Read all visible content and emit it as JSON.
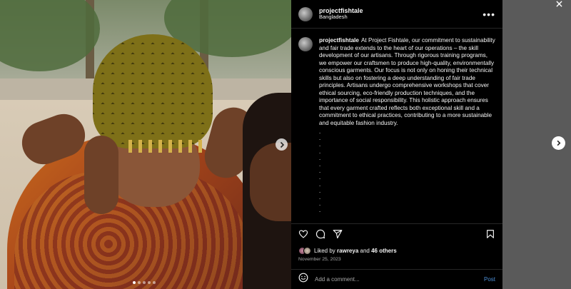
{
  "post": {
    "header": {
      "username": "projectfishtale",
      "location": "Bangladesh",
      "more_label": "•••"
    },
    "caption": {
      "username": "projectfishtale",
      "text": "At Project Fishtale, our commitment to sustainability and fair trade extends to the heart of our operations – the skill development of our artisans. Through rigorous training programs, we empower our craftsmen to produce high-quality, environmentally conscious garments. Our focus is not only on honing their technical skills but also on fostering a deep understanding of fair trade principles. Artisans undergo comprehensive workshops that cover ethical sourcing, eco-friendly production techniques, and the importance of social responsibility. This holistic approach ensures that every garment crafted reflects both exceptional skill and a commitment to ethical practices, contributing to a more sustainable and equitable fashion industry.",
      "dot_lines": [
        ".",
        ".",
        ".",
        ".",
        ".",
        ".",
        ".",
        ".",
        ".",
        ".",
        ".",
        ".",
        "."
      ]
    },
    "likes": {
      "prefix": "Liked by",
      "user": "rawreya",
      "joiner": "and",
      "others": "46 others"
    },
    "date": "November 25, 2023",
    "comment": {
      "placeholder": "Add a comment...",
      "post_label": "Post"
    },
    "carousel": {
      "slide_count": 5,
      "active_index": 0
    }
  },
  "icons": {
    "close": "close-icon",
    "next": "chevron-right-icon",
    "like": "heart-icon",
    "comment": "comment-icon",
    "share": "share-icon",
    "save": "bookmark-icon",
    "emoji": "emoji-icon",
    "more": "more-icon"
  },
  "colors": {
    "background": "#000000",
    "text": "#f5f5f5",
    "muted": "#a8a8a8",
    "link": "#4c8fd6",
    "overlay": "#5a5a5a"
  }
}
